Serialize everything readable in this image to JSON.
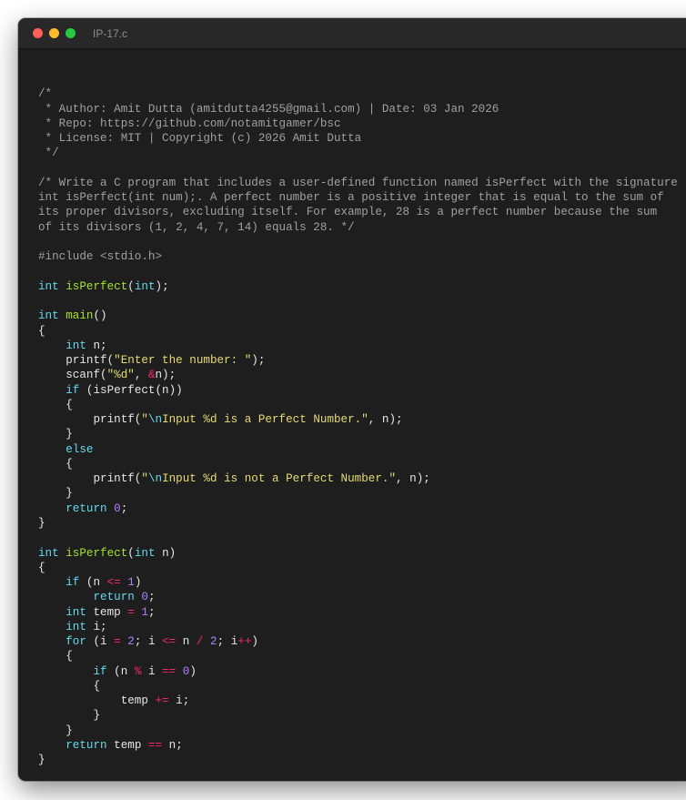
{
  "window": {
    "title": "IP-17.c",
    "buttons": {
      "close": "close",
      "minimize": "minimize",
      "zoom": "zoom"
    }
  },
  "colors": {
    "background": "#1e1e1e",
    "comment": "#a0a0a0",
    "keyword": "#66d9ef",
    "function": "#a6e22e",
    "string": "#e6db74",
    "number": "#ae81ff",
    "operator": "#f92672",
    "plain": "#e6e6e6"
  },
  "code": {
    "lines": [
      [],
      [
        {
          "t": "/*",
          "c": "cm"
        }
      ],
      [
        {
          "t": " * Author: Amit Dutta (amitdutta4255@gmail.com) | Date: 03 Jan 2026",
          "c": "cm"
        }
      ],
      [
        {
          "t": " * Repo: https://github.com/notamitgamer/bsc",
          "c": "cm"
        }
      ],
      [
        {
          "t": " * License: MIT | Copyright (c) 2026 Amit Dutta",
          "c": "cm"
        }
      ],
      [
        {
          "t": " */",
          "c": "cm"
        }
      ],
      [],
      [
        {
          "t": "/* Write a C program that includes a user-defined function named isPerfect with the signature",
          "c": "cm"
        }
      ],
      [
        {
          "t": "int isPerfect(int num);. A perfect number is a positive integer that is equal to the sum of",
          "c": "cm"
        }
      ],
      [
        {
          "t": "its proper divisors, excluding itself. For example, 28 is a perfect number because the sum",
          "c": "cm"
        }
      ],
      [
        {
          "t": "of its divisors (1, 2, 4, 7, 14) equals 28. */",
          "c": "cm"
        }
      ],
      [],
      [
        {
          "t": "#include <stdio.h>",
          "c": "pp"
        }
      ],
      [],
      [
        {
          "t": "int",
          "c": "kw"
        },
        {
          "t": " "
        },
        {
          "t": "isPerfect",
          "c": "fn"
        },
        {
          "t": "("
        },
        {
          "t": "int",
          "c": "kw"
        },
        {
          "t": ");"
        }
      ],
      [],
      [
        {
          "t": "int",
          "c": "kw"
        },
        {
          "t": " "
        },
        {
          "t": "main",
          "c": "fn"
        },
        {
          "t": "()"
        }
      ],
      [
        {
          "t": "{"
        }
      ],
      [
        {
          "t": "    "
        },
        {
          "t": "int",
          "c": "kw"
        },
        {
          "t": " n;"
        }
      ],
      [
        {
          "t": "    printf("
        },
        {
          "t": "\"Enter the number: \"",
          "c": "st"
        },
        {
          "t": ");"
        }
      ],
      [
        {
          "t": "    scanf("
        },
        {
          "t": "\"%d\"",
          "c": "st"
        },
        {
          "t": ", "
        },
        {
          "t": "&",
          "c": "op"
        },
        {
          "t": "n);"
        }
      ],
      [
        {
          "t": "    "
        },
        {
          "t": "if",
          "c": "kw"
        },
        {
          "t": " (isPerfect(n))"
        }
      ],
      [
        {
          "t": "    {"
        }
      ],
      [
        {
          "t": "        printf("
        },
        {
          "t": "\"",
          "c": "st"
        },
        {
          "t": "\\n",
          "c": "kw"
        },
        {
          "t": "Input %d is a Perfect Number.\"",
          "c": "st"
        },
        {
          "t": ", n);"
        }
      ],
      [
        {
          "t": "    }"
        }
      ],
      [
        {
          "t": "    "
        },
        {
          "t": "else",
          "c": "kw"
        }
      ],
      [
        {
          "t": "    {"
        }
      ],
      [
        {
          "t": "        printf("
        },
        {
          "t": "\"",
          "c": "st"
        },
        {
          "t": "\\n",
          "c": "kw"
        },
        {
          "t": "Input %d is not a Perfect Number.\"",
          "c": "st"
        },
        {
          "t": ", n);"
        }
      ],
      [
        {
          "t": "    }"
        }
      ],
      [
        {
          "t": "    "
        },
        {
          "t": "return",
          "c": "kw"
        },
        {
          "t": " "
        },
        {
          "t": "0",
          "c": "nm"
        },
        {
          "t": ";"
        }
      ],
      [
        {
          "t": "}"
        }
      ],
      [],
      [
        {
          "t": "int",
          "c": "kw"
        },
        {
          "t": " "
        },
        {
          "t": "isPerfect",
          "c": "fn"
        },
        {
          "t": "("
        },
        {
          "t": "int",
          "c": "kw"
        },
        {
          "t": " n)"
        }
      ],
      [
        {
          "t": "{"
        }
      ],
      [
        {
          "t": "    "
        },
        {
          "t": "if",
          "c": "kw"
        },
        {
          "t": " (n "
        },
        {
          "t": "<=",
          "c": "op"
        },
        {
          "t": " "
        },
        {
          "t": "1",
          "c": "nm"
        },
        {
          "t": ")"
        }
      ],
      [
        {
          "t": "        "
        },
        {
          "t": "return",
          "c": "kw"
        },
        {
          "t": " "
        },
        {
          "t": "0",
          "c": "nm"
        },
        {
          "t": ";"
        }
      ],
      [
        {
          "t": "    "
        },
        {
          "t": "int",
          "c": "kw"
        },
        {
          "t": " temp "
        },
        {
          "t": "=",
          "c": "op"
        },
        {
          "t": " "
        },
        {
          "t": "1",
          "c": "nm"
        },
        {
          "t": ";"
        }
      ],
      [
        {
          "t": "    "
        },
        {
          "t": "int",
          "c": "kw"
        },
        {
          "t": " i;"
        }
      ],
      [
        {
          "t": "    "
        },
        {
          "t": "for",
          "c": "kw"
        },
        {
          "t": " (i "
        },
        {
          "t": "=",
          "c": "op"
        },
        {
          "t": " "
        },
        {
          "t": "2",
          "c": "nm"
        },
        {
          "t": "; i "
        },
        {
          "t": "<=",
          "c": "op"
        },
        {
          "t": " n "
        },
        {
          "t": "/",
          "c": "op"
        },
        {
          "t": " "
        },
        {
          "t": "2",
          "c": "nm"
        },
        {
          "t": "; i"
        },
        {
          "t": "++",
          "c": "op"
        },
        {
          "t": ")"
        }
      ],
      [
        {
          "t": "    {"
        }
      ],
      [
        {
          "t": "        "
        },
        {
          "t": "if",
          "c": "kw"
        },
        {
          "t": " (n "
        },
        {
          "t": "%",
          "c": "op"
        },
        {
          "t": " i "
        },
        {
          "t": "==",
          "c": "op"
        },
        {
          "t": " "
        },
        {
          "t": "0",
          "c": "nm"
        },
        {
          "t": ")"
        }
      ],
      [
        {
          "t": "        {"
        }
      ],
      [
        {
          "t": "            temp "
        },
        {
          "t": "+=",
          "c": "op"
        },
        {
          "t": " i;"
        }
      ],
      [
        {
          "t": "        }"
        }
      ],
      [
        {
          "t": "    }"
        }
      ],
      [
        {
          "t": "    "
        },
        {
          "t": "return",
          "c": "kw"
        },
        {
          "t": " temp "
        },
        {
          "t": "==",
          "c": "op"
        },
        {
          "t": " n;"
        }
      ],
      [
        {
          "t": "}"
        }
      ]
    ]
  }
}
